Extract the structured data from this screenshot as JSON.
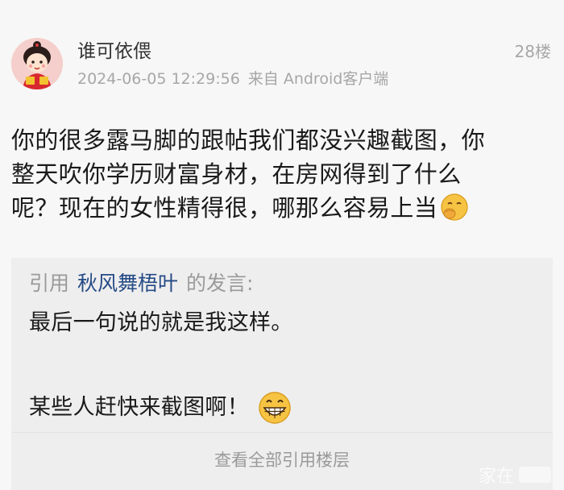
{
  "post": {
    "username": "谁可依偎",
    "timestamp": "2024-06-05 12:29:56",
    "source": "来自 Android客户端",
    "floor": "28楼",
    "body_lines": [
      "你的很多露马脚的跟帖我们都没兴趣截图，你",
      "整天吹你学历财富身材，在房网得到了什么",
      "呢？现在的女性精得很，哪那么容易上当"
    ],
    "body_emoji": "hand-over-mouth-emoji"
  },
  "quote": {
    "prefix": "引用",
    "author": "秋风舞梧叶",
    "suffix": "的发言:",
    "line1": "最后一句说的就是我这样。",
    "line2": "某些人赶快来截图啊！",
    "line2_emoji": "grinning-face-emoji",
    "view_all": "查看全部引用楼层"
  },
  "colors": {
    "background": "#f7f7f7",
    "quote_background": "#eeeeee",
    "author_link": "#254a86",
    "meta_text": "#a7a7a7"
  }
}
